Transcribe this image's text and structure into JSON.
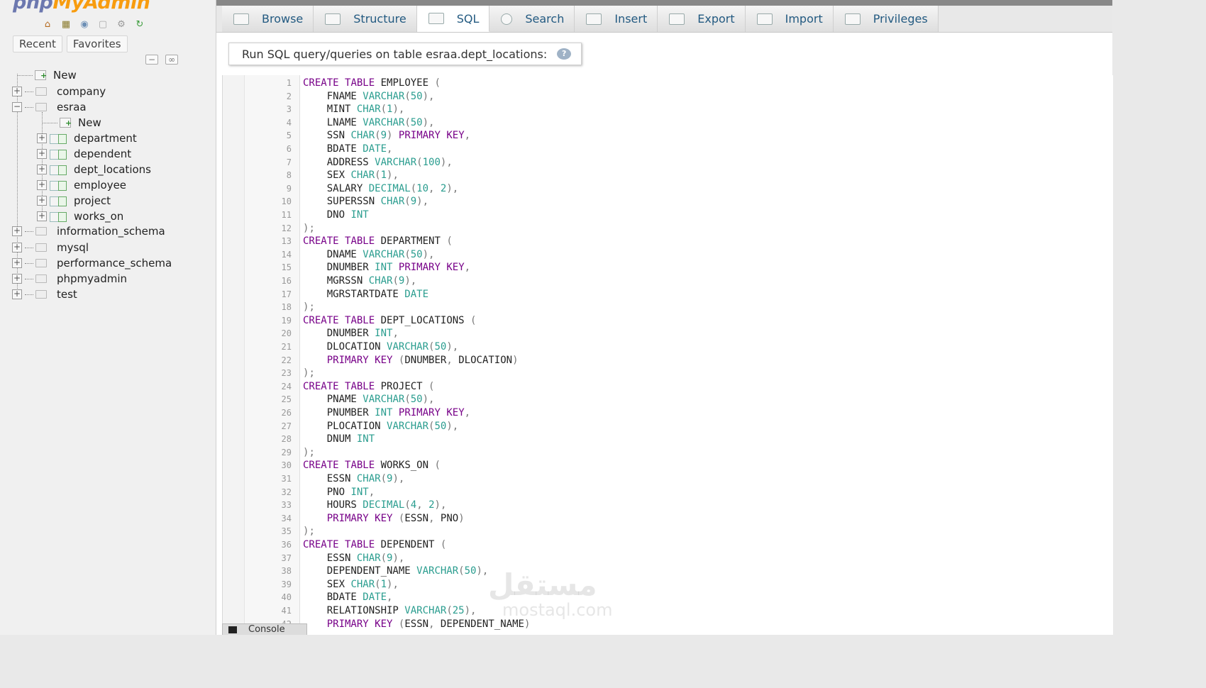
{
  "logo": {
    "left": "php",
    "right": "MyAdmin"
  },
  "quick_icons": [
    "home-icon",
    "database-icon",
    "help-icon",
    "docs-icon",
    "settings-icon",
    "reload-icon"
  ],
  "sidebar_tabs": [
    "Recent",
    "Favorites"
  ],
  "tree": {
    "new_label": "New",
    "databases": [
      "company",
      "esraa",
      "information_schema",
      "mysql",
      "performance_schema",
      "phpmyadmin",
      "test"
    ],
    "esraa_new": "New",
    "esraa_tables": [
      "department",
      "dependent",
      "dept_locations",
      "employee",
      "project",
      "works_on"
    ]
  },
  "tabs": [
    "Browse",
    "Structure",
    "SQL",
    "Search",
    "Insert",
    "Export",
    "Import",
    "Privileges"
  ],
  "active_tab": "SQL",
  "query_header": "Run SQL query/queries on table esraa.dept_locations:",
  "console_label": "Console",
  "watermark": {
    "line1": "مستقل",
    "line2": "mostaql.com"
  },
  "code_lines": [
    "CREATE TABLE EMPLOYEE (",
    "    FNAME VARCHAR(50),",
    "    MINT CHAR(1),",
    "    LNAME VARCHAR(50),",
    "    SSN CHAR(9) PRIMARY KEY,",
    "    BDATE DATE,",
    "    ADDRESS VARCHAR(100),",
    "    SEX CHAR(1),",
    "    SALARY DECIMAL(10, 2),",
    "    SUPERSSN CHAR(9),",
    "    DNO INT",
    ");",
    "CREATE TABLE DEPARTMENT (",
    "    DNAME VARCHAR(50),",
    "    DNUMBER INT PRIMARY KEY,",
    "    MGRSSN CHAR(9),",
    "    MGRSTARTDATE DATE",
    ");",
    "CREATE TABLE DEPT_LOCATIONS (",
    "    DNUMBER INT,",
    "    DLOCATION VARCHAR(50),",
    "    PRIMARY KEY (DNUMBER, DLOCATION)",
    ");",
    "CREATE TABLE PROJECT (",
    "    PNAME VARCHAR(50),",
    "    PNUMBER INT PRIMARY KEY,",
    "    PLOCATION VARCHAR(50),",
    "    DNUM INT",
    ");",
    "CREATE TABLE WORKS_ON (",
    "    ESSN CHAR(9),",
    "    PNO INT,",
    "    HOURS DECIMAL(4, 2),",
    "    PRIMARY KEY (ESSN, PNO)",
    ");",
    "CREATE TABLE DEPENDENT (",
    "    ESSN CHAR(9),",
    "    DEPENDENT_NAME VARCHAR(50),",
    "    SEX CHAR(1),",
    "    BDATE DATE,",
    "    RELATIONSHIP VARCHAR(25),",
    "    PRIMARY KEY (ESSN, DEPENDENT_NAME)"
  ]
}
